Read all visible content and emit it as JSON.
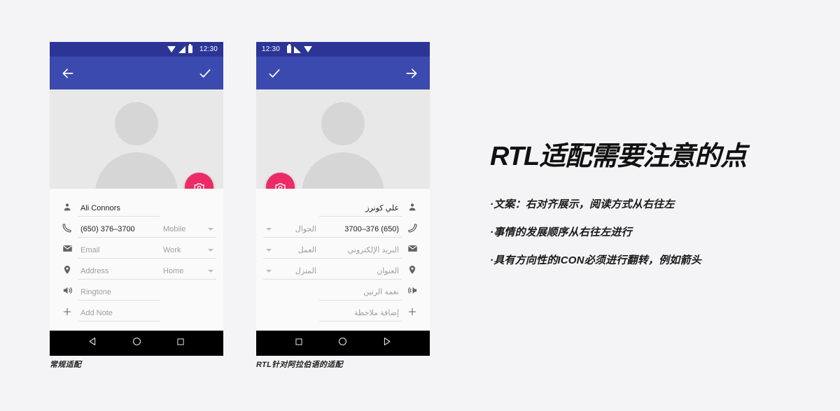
{
  "canvas": {
    "background": "#f4f4f6"
  },
  "colors": {
    "status_bar": "#2c3596",
    "app_bar": "#3b4aae",
    "fab": "#ec2b66",
    "hero_bg": "#e8e8e8",
    "avatar": "#d6d6d6",
    "nav_bar": "#000000",
    "text_primary": "#212121",
    "text_hint": "#9e9e9e"
  },
  "phone_ltr": {
    "direction": "ltr",
    "status": {
      "clock": "12:30",
      "icons": [
        "wifi-icon",
        "signal-icon",
        "battery-icon"
      ]
    },
    "app_bar": {
      "back_label": "back-arrow-icon",
      "confirm_label": "check-icon"
    },
    "hero": {
      "avatar_name": "avatar-placeholder",
      "fab_name": "camera-fab"
    },
    "fields": [
      {
        "icon": "person-icon",
        "value": "Ali Connors",
        "filled": true,
        "type": "",
        "has_type": false
      },
      {
        "icon": "phone-icon",
        "value": "(650) 376–3700",
        "filled": true,
        "type": "Mobile",
        "has_type": true
      },
      {
        "icon": "email-icon",
        "value": "Email",
        "filled": false,
        "type": "Work",
        "has_type": true
      },
      {
        "icon": "location-icon",
        "value": "Address",
        "filled": false,
        "type": "Home",
        "has_type": true
      },
      {
        "icon": "ringtone-icon",
        "value": "Ringtone",
        "filled": false,
        "type": "",
        "has_type": false
      },
      {
        "icon": "plus-icon",
        "value": "Add Note",
        "filled": false,
        "type": "",
        "has_type": false
      }
    ],
    "nav": [
      "back-triangle-icon",
      "home-circle-icon",
      "recents-square-icon"
    ],
    "caption": "常规适配"
  },
  "phone_rtl": {
    "direction": "rtl",
    "status": {
      "clock": "12:30",
      "icons": [
        "battery-icon",
        "signal-icon",
        "wifi-icon"
      ]
    },
    "app_bar": {
      "back_label": "forward-arrow-icon",
      "confirm_label": "check-icon"
    },
    "hero": {
      "avatar_name": "avatar-placeholder",
      "fab_name": "camera-fab"
    },
    "fields": [
      {
        "icon": "person-icon",
        "value": "علي كونرز",
        "filled": true,
        "type": "",
        "has_type": false
      },
      {
        "icon": "phone-icon",
        "value": "(650) 376–3700",
        "filled": true,
        "type": "الجوال",
        "has_type": true
      },
      {
        "icon": "email-icon",
        "value": "البريد الإلكتروني",
        "filled": false,
        "type": "العمل",
        "has_type": true
      },
      {
        "icon": "location-icon",
        "value": "العنوان",
        "filled": false,
        "type": "المنزل",
        "has_type": true
      },
      {
        "icon": "ringtone-icon",
        "value": "نغمة الرنين",
        "filled": false,
        "type": "",
        "has_type": false
      },
      {
        "icon": "plus-icon",
        "value": "إضافة ملاحظة",
        "filled": false,
        "type": "",
        "has_type": false
      }
    ],
    "nav": [
      "recents-square-icon",
      "home-circle-icon",
      "back-triangle-icon"
    ],
    "caption": "RTL针对阿拉伯语的适配"
  },
  "panel": {
    "title": "RTL适配需要注意的点",
    "bullets": [
      "·文案：右对齐展示，阅读方式从右往左",
      "·事情的发展顺序从右往左进行",
      "·具有方向性的ICON必须进行翻转，例如箭头"
    ]
  }
}
